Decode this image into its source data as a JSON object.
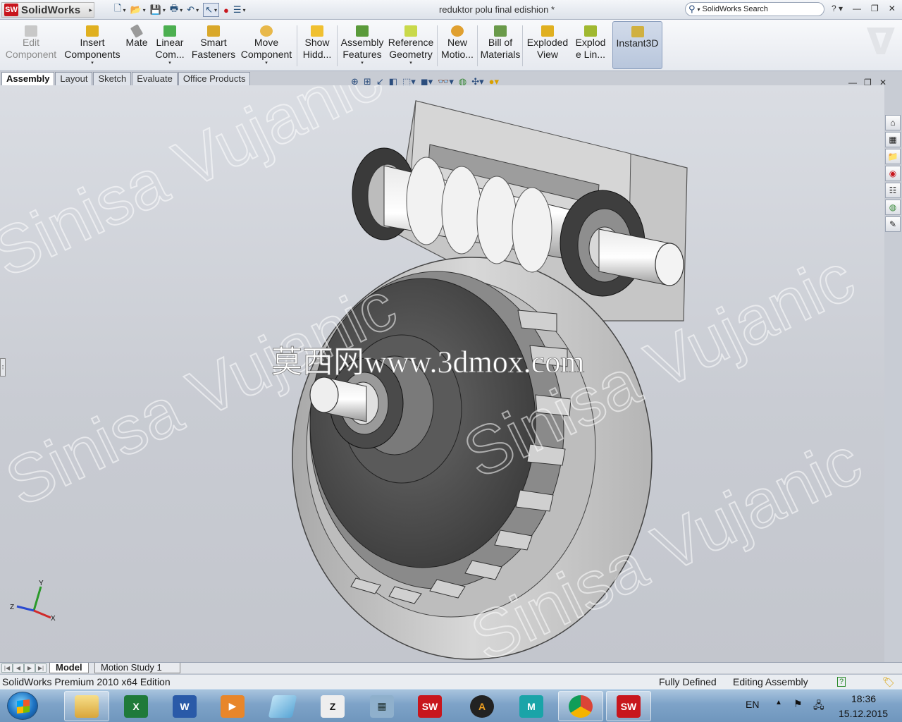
{
  "app": {
    "logo_text": "SolidWorks",
    "logo_mark": "SW",
    "doc_title": "reduktor polu final edishion *"
  },
  "search": {
    "placeholder": "SolidWorks Search"
  },
  "quick_access": [
    {
      "name": "new-document-icon"
    },
    {
      "name": "open-folder-icon"
    },
    {
      "name": "save-icon"
    },
    {
      "name": "print-icon"
    },
    {
      "name": "undo-icon"
    },
    {
      "name": "select-arrow-icon"
    },
    {
      "name": "rebuild-traffic-light-icon"
    },
    {
      "name": "options-list-icon"
    }
  ],
  "commands": [
    {
      "label1": "Edit",
      "label2": "Component",
      "disabled": true
    },
    {
      "label1": "Insert",
      "label2": "Components",
      "dropdown": true
    },
    {
      "label1": "Mate",
      "label2": ""
    },
    {
      "label1": "Linear",
      "label2": "Com...",
      "dropdown": true
    },
    {
      "label1": "Smart",
      "label2": "Fasteners"
    },
    {
      "label1": "Move",
      "label2": "Component",
      "dropdown": true
    },
    {
      "label1": "Show",
      "label2": "Hidd..."
    },
    {
      "label1": "Assembly",
      "label2": "Features",
      "dropdown": true
    },
    {
      "label1": "Reference",
      "label2": "Geometry",
      "dropdown": true
    },
    {
      "label1": "New",
      "label2": "Motio..."
    },
    {
      "label1": "Bill of",
      "label2": "Materials"
    },
    {
      "label1": "Exploded",
      "label2": "View"
    },
    {
      "label1": "Explod",
      "label2": "e Lin..."
    },
    {
      "label1": "Instant3D",
      "label2": "",
      "active": true
    }
  ],
  "tabs": [
    "Assembly",
    "Layout",
    "Sketch",
    "Evaluate",
    "Office Products"
  ],
  "watermark": {
    "text": "Sinisa Vujanic",
    "site": "莫西网www.3dmox.com"
  },
  "triad": {
    "x": "X",
    "y": "Y",
    "z": "Z"
  },
  "bottom_tabs": [
    "Model",
    "Motion Study 1"
  ],
  "status": {
    "edition": "SolidWorks Premium 2010 x64 Edition",
    "defined": "Fully Defined",
    "mode": "Editing Assembly"
  },
  "taskbar": {
    "apps": [
      {
        "name": "explorer",
        "label": ""
      },
      {
        "name": "excel",
        "label": "X"
      },
      {
        "name": "word",
        "label": "W"
      },
      {
        "name": "media-player",
        "label": "▶"
      },
      {
        "name": "notes",
        "label": ""
      },
      {
        "name": "zbrush",
        "label": "Z"
      },
      {
        "name": "calculator",
        "label": "▦"
      },
      {
        "name": "solidworks",
        "label": "SW"
      },
      {
        "name": "autodesk",
        "label": "A"
      },
      {
        "name": "maya",
        "label": "M"
      },
      {
        "name": "chrome",
        "label": ""
      },
      {
        "name": "solidworks-open",
        "label": "SW"
      }
    ],
    "lang": "EN",
    "time": "18:36",
    "date": "15.12.2015"
  },
  "colors": {
    "accent": "#2b4d7d",
    "sw_red": "#c8161d",
    "viewport_bg": "#c9ccd3"
  }
}
